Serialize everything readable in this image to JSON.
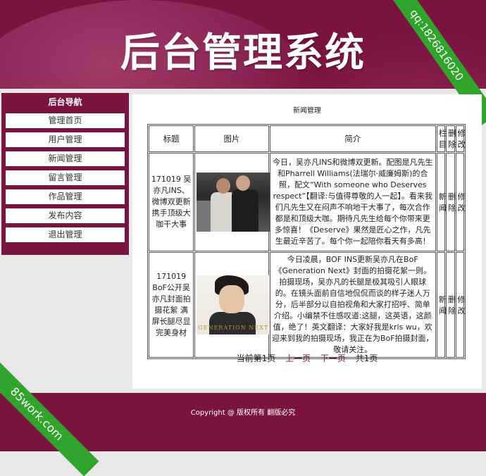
{
  "header": {
    "title": "后台管理系统"
  },
  "ribbons": {
    "top_right": "qq:1826816020",
    "bottom_left": "85work.com"
  },
  "sidebar": {
    "title": "后台导航",
    "items": [
      {
        "label": "管理首页"
      },
      {
        "label": "用户管理"
      },
      {
        "label": "新闻管理"
      },
      {
        "label": "留言管理"
      },
      {
        "label": "作品管理"
      },
      {
        "label": "发布内容"
      },
      {
        "label": "退出管理"
      }
    ]
  },
  "main": {
    "title": "新闻管理",
    "table": {
      "headers": [
        "标题",
        "图片",
        "简介",
        "栏目",
        "删除",
        "修改"
      ],
      "rows": [
        {
          "title": "171019 吴亦凡INS、微博双更新携手顶级大咖干大事",
          "photo_caption": "",
          "desc": "今日，吴亦凡INS和微博双更新。配图是凡先生和Pharrell Williams(法瑞尔·威廉姆斯)的合照，配文“With someone who Deserves respect”【翻译:与值得尊敬的人一起】。看来我们凡先生又在闷声不响地干大事了，每次合作都是和顶级大咖。期待凡先生给每个你带来更多惊喜！《Deserve》果然是匠心之作，凡先生最近辛苦了。每个你一起陪你看天有多高！",
          "column": "新闻",
          "delete": "删除",
          "edit": "修改"
        },
        {
          "title": "171019 BoF公开吴亦凡封面拍摄花絮 满屏长腿尽显完美身材",
          "photo_caption": "GENERATION NEXT",
          "desc": "今日凌晨，BOF INS更新吴亦凡在BoF《Generation Next》封面的拍摄花絮一则。拍摄现场，吴亦凡的长腿是极其吸引人眼球的。在镜头面前自信地侃侃而谈的样子迷人万分，后半部分以自拍视角和大家打招呼、简单介绍。小编禁不住感叹道:这腿，这英语，这颜值，绝了！英文翻译：大家好我是kris wu，欢迎来到我的拍摄现场，我正在为BoF拍摄封面，敬请关注。",
          "column": "新闻",
          "delete": "删除",
          "edit": "修改"
        }
      ]
    },
    "pager": {
      "current": "当前第1页",
      "prev": "上一页",
      "next": "下一页",
      "total": "共1页"
    }
  },
  "footer": {
    "text": "Copyright @ 版权所有 翻版必究"
  },
  "colors": {
    "brand": "#7a1340",
    "ribbon": "#2fa52b"
  }
}
